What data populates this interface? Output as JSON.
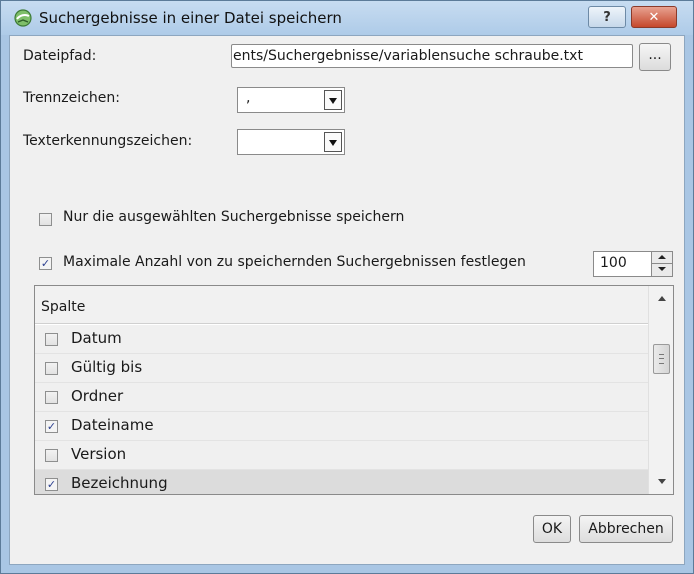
{
  "window": {
    "title": "Suchergebnisse in einer Datei speichern",
    "help_label": "?",
    "close_label": "✕",
    "icon": "save-results-icon"
  },
  "form": {
    "dateipfad_label": "Dateipfad:",
    "dateipfad_value": "ents/Suchergebnisse/variablensuche schraube.txt",
    "browse_label": "...",
    "trennzeichen_label": "Trennzeichen:",
    "trennzeichen_value": ",",
    "texterkennung_label": "Texterkennungszeichen:",
    "texterkennung_value": "",
    "only_selected_label": "Nur die ausgewählten Suchergebnisse speichern",
    "only_selected_checked": false,
    "max_count_label": "Maximale Anzahl von zu speichernden Suchergebnissen festlegen",
    "max_count_checked": true,
    "max_count_value": "100"
  },
  "columns": {
    "header": "Spalte",
    "items": [
      {
        "label": "Datum",
        "checked": false
      },
      {
        "label": "Gültig bis",
        "checked": false
      },
      {
        "label": "Ordner",
        "checked": false
      },
      {
        "label": "Dateiname",
        "checked": true
      },
      {
        "label": "Version",
        "checked": false
      },
      {
        "label": "Bezeichnung",
        "checked": true
      }
    ]
  },
  "buttons": {
    "ok": "OK",
    "cancel": "Abbrechen"
  },
  "colors": {
    "titlebar": "#aecbe8",
    "close_button": "#c5482c",
    "dialog_bg": "#f0f0f0",
    "check_mark": "#2b3f8f"
  }
}
